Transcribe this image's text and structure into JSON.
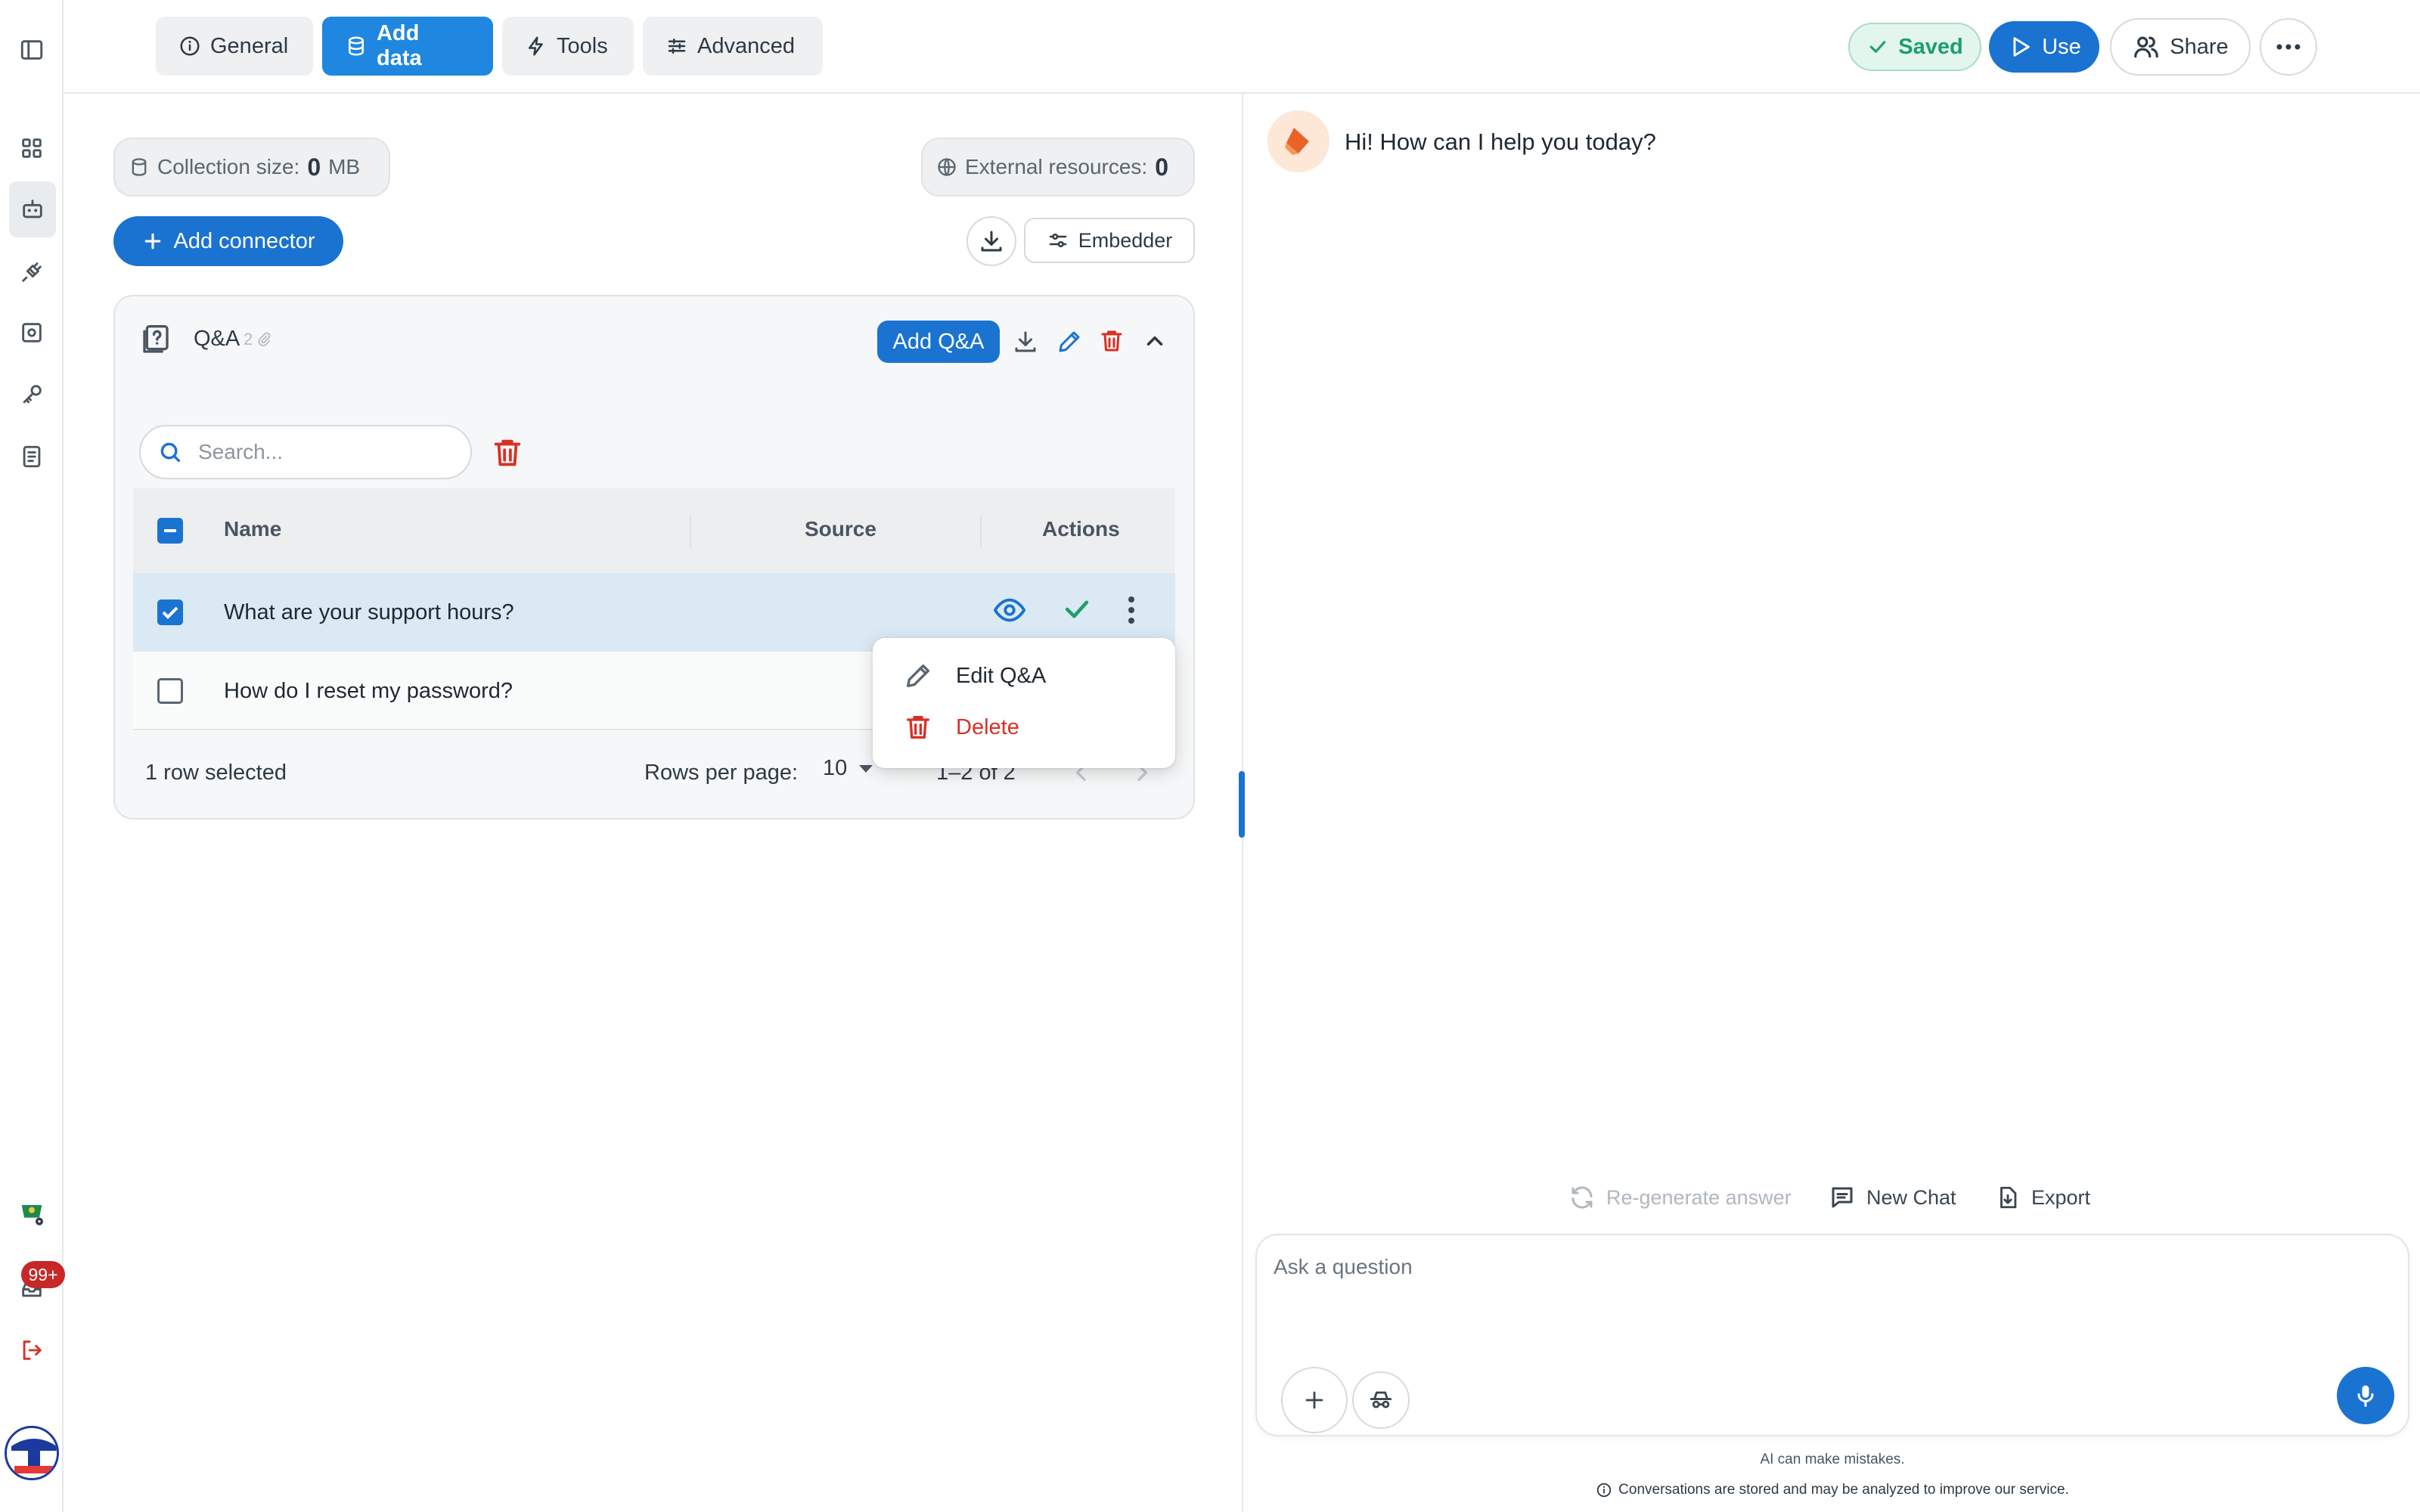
{
  "tabs": [
    {
      "label": "General"
    },
    {
      "label": "Add data"
    },
    {
      "label": "Tools"
    },
    {
      "label": "Advanced"
    }
  ],
  "header": {
    "saved_label": "Saved",
    "use_label": "Use",
    "share_label": "Share"
  },
  "rail": {
    "badge": "99+"
  },
  "data_panel": {
    "collection_label": "Collection size:",
    "collection_value": "0",
    "collection_unit": "MB",
    "external_label": "External resources:",
    "external_value": "0",
    "add_connector_label": "Add connector",
    "embedder_label": "Embedder"
  },
  "qa": {
    "title": "Q&A",
    "count": "2",
    "add_label": "Add Q&A",
    "search_placeholder": "Search...",
    "columns": [
      "Name",
      "Source",
      "Actions"
    ],
    "rows": [
      {
        "name": "What are your support hours?",
        "selected": true
      },
      {
        "name": "How do I reset my password?",
        "selected": false
      }
    ],
    "footer": {
      "selection": "1 row selected",
      "rows_per_page_label": "Rows per page:",
      "rows_per_page_value": "10",
      "range": "1–2 of 2"
    },
    "menu": {
      "edit_label": "Edit Q&A",
      "delete_label": "Delete"
    }
  },
  "chat": {
    "greeting": "Hi! How can I help you today?",
    "regenerate_label": "Re-generate answer",
    "new_chat_label": "New Chat",
    "export_label": "Export",
    "input_placeholder": "Ask a question",
    "disclaimer": "AI can make mistakes.",
    "privacy_note": "Conversations are stored and may be analyzed to improve our service."
  },
  "colors": {
    "accent": "#1f87e0",
    "danger": "#d93025",
    "success": "#1e9e6a",
    "saved_bg": "#e3f6ee"
  }
}
